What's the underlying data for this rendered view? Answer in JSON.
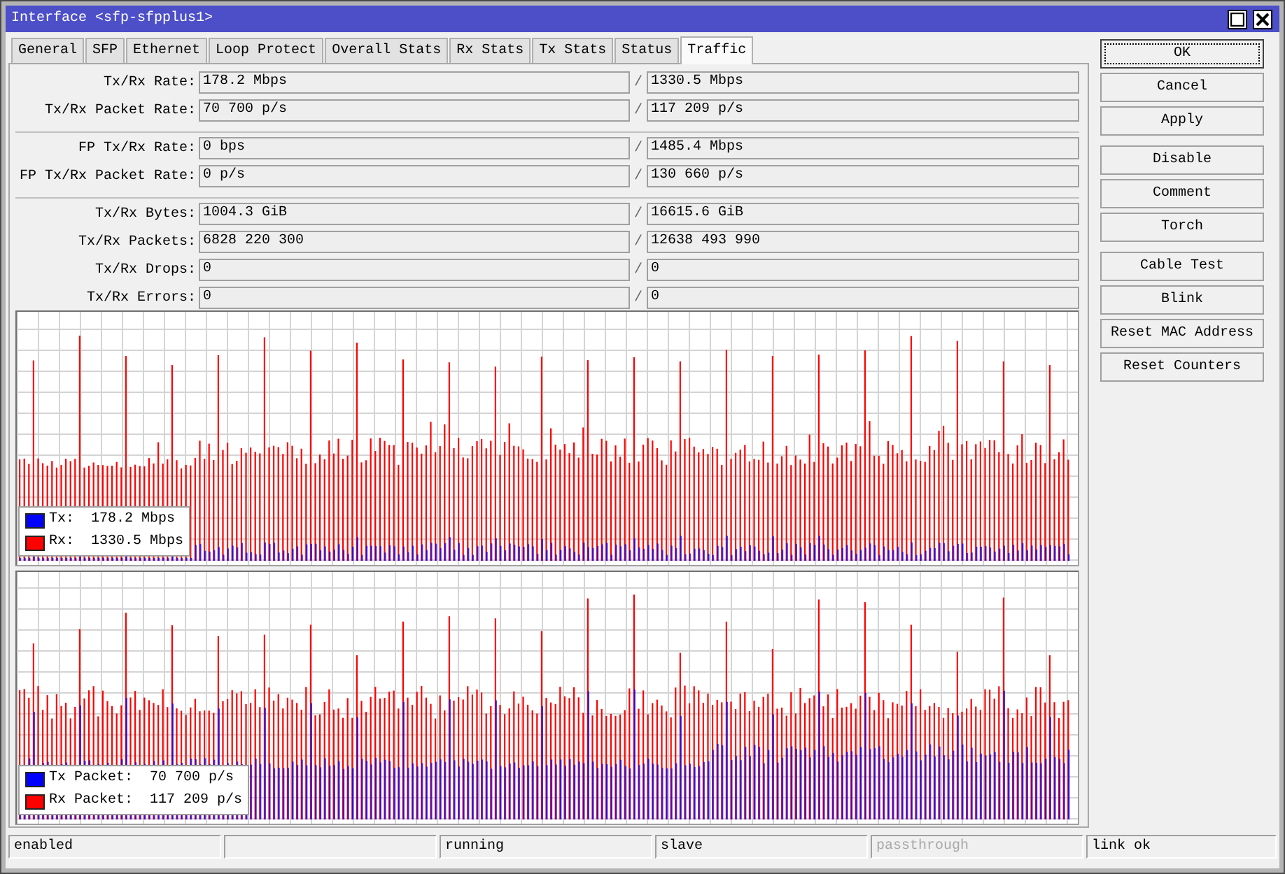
{
  "window": {
    "title": "Interface <sfp-sfpplus1>"
  },
  "tabs": [
    {
      "label": "General",
      "selected": false
    },
    {
      "label": "SFP",
      "selected": false
    },
    {
      "label": "Ethernet",
      "selected": false
    },
    {
      "label": "Loop Protect",
      "selected": false
    },
    {
      "label": "Overall Stats",
      "selected": false
    },
    {
      "label": "Rx Stats",
      "selected": false
    },
    {
      "label": "Tx Stats",
      "selected": false
    },
    {
      "label": "Status",
      "selected": false
    },
    {
      "label": "Traffic",
      "selected": true
    }
  ],
  "sections": [
    {
      "rows": [
        {
          "label": "Tx/Rx Rate:",
          "tx": "178.2 Mbps",
          "separator": "/",
          "rx": "1330.5 Mbps"
        },
        {
          "label": "Tx/Rx Packet Rate:",
          "tx": "70 700 p/s",
          "separator": "/",
          "rx": "117 209 p/s"
        }
      ]
    },
    {
      "rows": [
        {
          "label": "FP Tx/Rx Rate:",
          "tx": "0 bps",
          "separator": "/",
          "rx": "1485.4 Mbps"
        },
        {
          "label": "FP Tx/Rx Packet Rate:",
          "tx": "0 p/s",
          "separator": "/",
          "rx": "130 660 p/s"
        }
      ]
    },
    {
      "rows": [
        {
          "label": "Tx/Rx Bytes:",
          "tx": "1004.3 GiB",
          "separator": "/",
          "rx": "16615.6 GiB"
        },
        {
          "label": "Tx/Rx Packets:",
          "tx": "6828 220 300",
          "separator": "/",
          "rx": "12638 493 990"
        },
        {
          "label": "Tx/Rx Drops:",
          "tx": "0",
          "separator": "/",
          "rx": "0"
        },
        {
          "label": "Tx/Rx Errors:",
          "tx": "0",
          "separator": "/",
          "rx": "0"
        }
      ]
    }
  ],
  "charts": [
    {
      "legend": [
        {
          "label": "Tx:",
          "value": "178.2 Mbps",
          "color": "#0000ff"
        },
        {
          "label": "Rx:",
          "value": "1330.5 Mbps",
          "color": "#ff0000"
        }
      ]
    },
    {
      "legend": [
        {
          "label": "Tx Packet:",
          "value": "70 700 p/s",
          "color": "#0000ff"
        },
        {
          "label": "Rx Packet:",
          "value": "117 209 p/s",
          "color": "#ff0000"
        }
      ]
    }
  ],
  "button_groups": [
    {
      "buttons": [
        {
          "label": "OK",
          "focused": true
        },
        {
          "label": "Cancel",
          "focused": false
        },
        {
          "label": "Apply",
          "focused": false
        }
      ]
    },
    {
      "buttons": [
        {
          "label": "Disable",
          "focused": false
        },
        {
          "label": "Comment",
          "focused": false
        },
        {
          "label": "Torch",
          "focused": false
        }
      ]
    },
    {
      "buttons": [
        {
          "label": "Cable Test",
          "focused": false
        },
        {
          "label": "Blink",
          "focused": false
        },
        {
          "label": "Reset MAC Address",
          "focused": false
        },
        {
          "label": "Reset Counters",
          "focused": false
        }
      ]
    }
  ],
  "status_bar": [
    {
      "kind": "text",
      "text": "enabled",
      "disabled": false
    },
    {
      "kind": "blank"
    },
    {
      "kind": "text",
      "text": "running",
      "disabled": false
    },
    {
      "kind": "text",
      "text": "slave",
      "disabled": false
    },
    {
      "kind": "text",
      "text": "passthrough",
      "disabled": true
    },
    {
      "kind": "text",
      "text": "link ok",
      "disabled": false
    }
  ]
}
